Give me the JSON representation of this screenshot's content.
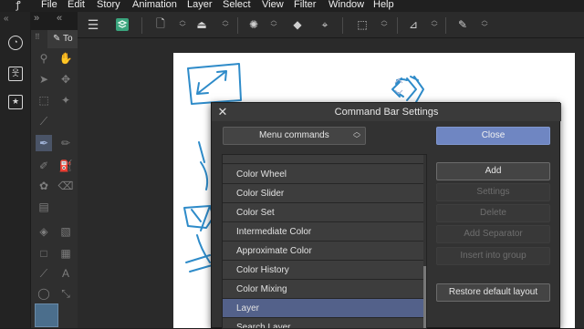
{
  "menubar": {
    "items": [
      "File",
      "Edit",
      "Story",
      "Animation",
      "Layer",
      "Select",
      "View",
      "Filter",
      "Window",
      "Help"
    ]
  },
  "tool_palette": {
    "tab_label": "To"
  },
  "dialog": {
    "title": "Command Bar Settings",
    "category_select": "Menu commands",
    "list_items": [
      "Color Wheel",
      "Color Slider",
      "Color Set",
      "Intermediate Color",
      "Approximate Color",
      "Color History",
      "Color Mixing",
      "Layer",
      "Search Layer"
    ],
    "selected_item": "Layer",
    "buttons": {
      "close": "Close",
      "add": "Add",
      "settings": "Settings",
      "delete": "Delete",
      "add_separator": "Add Separator",
      "insert_into_group": "Insert into group",
      "restore_default": "Restore default layout"
    }
  },
  "colors": {
    "accent": "#6f86c2",
    "selection": "#53618a",
    "sketch_blue": "#2e8bc9"
  }
}
